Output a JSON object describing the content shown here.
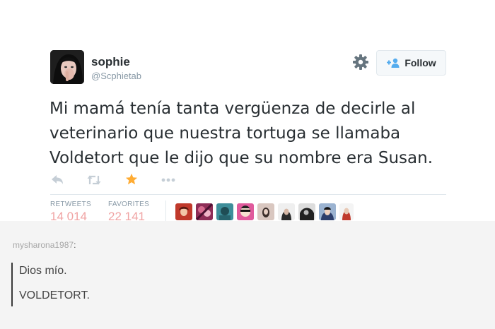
{
  "tweet": {
    "display_name": "sophie",
    "username": "@Scphietab",
    "follow_label": "Follow",
    "text_lines": [
      "Mi mamá tenía tanta vergüenza de decirle al",
      "veterinario que nuestra tortuga se llamaba",
      "Voldetort que le dijo que su nombre era Susan."
    ],
    "actions": [
      "reply-icon",
      "retweet-icon",
      "favorite-star-icon",
      "more-icon"
    ],
    "stats": {
      "retweets_label": "RETWEETS",
      "retweets_value": "14 014",
      "favorites_label": "FAVORITES",
      "favorites_value": "22 141"
    },
    "favoriter_avatars": [
      {
        "icon": "avatar-1",
        "color": "#c0392b"
      },
      {
        "icon": "avatar-2",
        "color": "#8e2d57"
      },
      {
        "icon": "avatar-3",
        "color": "#3e8e9a"
      },
      {
        "icon": "avatar-4",
        "color": "#e05a9c"
      },
      {
        "icon": "avatar-5",
        "color": "#d9c7c0"
      },
      {
        "icon": "avatar-6",
        "color": "#3a3a3a"
      },
      {
        "icon": "avatar-7",
        "color": "#222222"
      },
      {
        "icon": "avatar-8",
        "color": "#2d3e6b"
      },
      {
        "icon": "avatar-9",
        "color": "#e8c9b5"
      }
    ],
    "colors": {
      "name": "#292f33",
      "muted": "#8899a6",
      "star": "#ffac33",
      "stat_value": "#f0a4a4",
      "follow_icon": "#55acee"
    }
  },
  "reblog": {
    "username": "mysharona1987",
    "colon": ":",
    "lines": [
      "Dios mío.",
      "VOLDETORT."
    ]
  }
}
